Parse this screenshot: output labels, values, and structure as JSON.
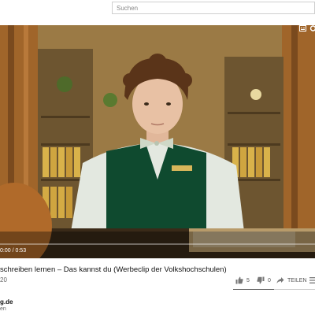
{
  "search": {
    "placeholder": "Suchen"
  },
  "player": {
    "time": "0:00 / 0:53",
    "progress_fraction": 0.0
  },
  "video": {
    "title": "schreiben lernen – Das kannst du (Werbeclip der Volkshochschulen)",
    "views": "20",
    "likes": "5",
    "dislikes": "0",
    "share_label": "TEILEN",
    "like_ratio_fraction": 0.5
  },
  "channel": {
    "name": "g.de",
    "subtitle": "en"
  },
  "colors": {
    "progress": "#ff0000",
    "vest": "#0f4a2f",
    "background_wall": "#8a6a3a"
  },
  "icons": [
    "thumbs-up-icon",
    "thumbs-down-icon",
    "share-icon",
    "more-icon",
    "subtitles-icon",
    "settings-icon"
  ]
}
